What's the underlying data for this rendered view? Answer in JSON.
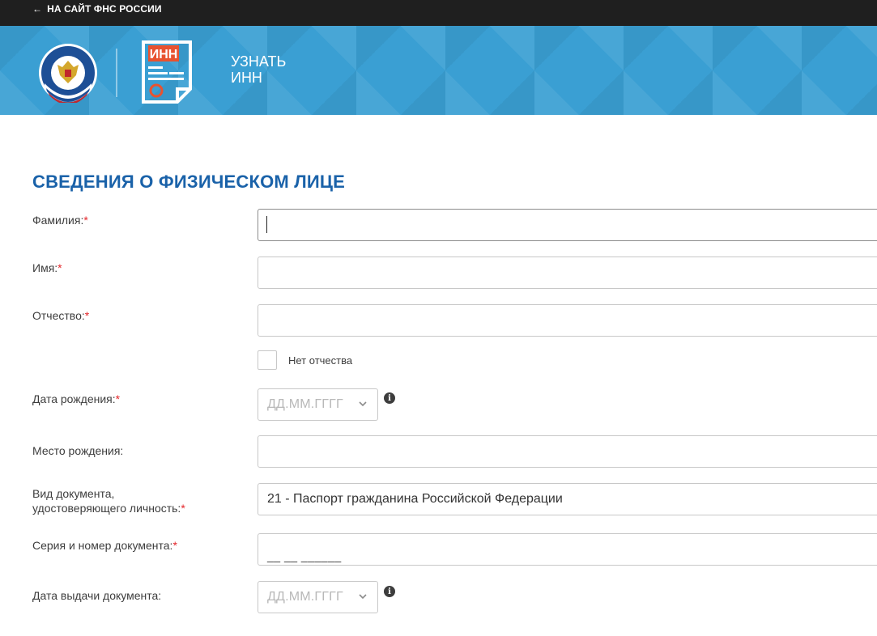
{
  "topbar": {
    "back_label": "НА САЙТ ФНС РОССИИ"
  },
  "header": {
    "title_line1": "УЗНАТЬ",
    "title_line2": "ИНН",
    "doc_icon_text": "ИНН"
  },
  "form": {
    "section_title": "СВЕДЕНИЯ О ФИЗИЧЕСКОМ ЛИЦЕ",
    "required_mark": "*",
    "fields": {
      "surname_label": "Фамилия:",
      "name_label": "Имя:",
      "patronymic_label": "Отчество:",
      "no_patronymic_label": "Нет отчества",
      "birth_date_label": "Дата рождения:",
      "birth_date_placeholder": "ДД.ММ.ГГГГ",
      "birth_place_label": "Место рождения:",
      "doc_type_label_line1": "Вид документа,",
      "doc_type_label_line2": "удостоверяющего личность:",
      "doc_type_value": "21 - Паспорт гражданина Российской Федерации",
      "doc_number_label": "Серия и номер документа:",
      "doc_number_mask": "__ __ ______",
      "issue_date_label": "Дата выдачи документа:",
      "issue_date_placeholder": "ДД.ММ.ГГГГ"
    }
  },
  "icons": {
    "back": "arrow-left-icon",
    "info": "info-icon",
    "chevron": "chevron-down-icon",
    "info_glyph": "i"
  },
  "colors": {
    "topbar": "#1f1f1f",
    "header_blue": "#3a9fd3",
    "title_blue": "#1a62a9",
    "required_red": "#e4262a",
    "doc_icon_orange": "#e8522f"
  }
}
